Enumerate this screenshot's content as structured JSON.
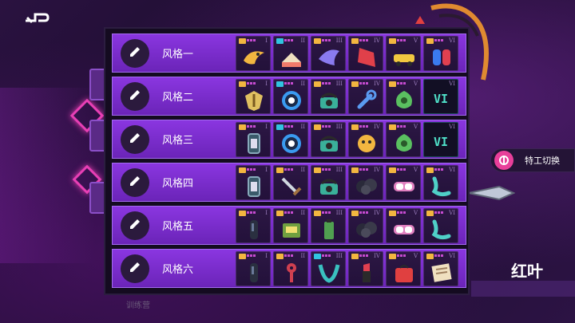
{
  "agent_switch": {
    "label": "特工切换"
  },
  "character": {
    "name": "红叶"
  },
  "bottom_hint": "训练营",
  "rows": [
    {
      "name": "风格一",
      "slots": [
        {
          "roman": "I",
          "tag": "yellow",
          "item": "golden-bird-icon",
          "color": "#f2b640"
        },
        {
          "roman": "II",
          "tag": "cyan",
          "item": "cake-icon",
          "color": "#f07a6a"
        },
        {
          "roman": "III",
          "tag": "yellow",
          "item": "blue-bird-icon",
          "color": "#8a7af0"
        },
        {
          "roman": "IV",
          "tag": "yellow",
          "item": "red-cape-icon",
          "color": "#e0404a"
        },
        {
          "roman": "V",
          "tag": "yellow",
          "item": "yellow-car-icon",
          "color": "#f2c840"
        },
        {
          "roman": "VI",
          "tag": "yellow",
          "item": "joycon-icon",
          "color": "#3a7af0"
        }
      ]
    },
    {
      "name": "风格二",
      "slots": [
        {
          "roman": "I",
          "tag": "yellow",
          "item": "crest-icon",
          "color": "#e0c060"
        },
        {
          "roman": "II",
          "tag": "cyan",
          "item": "target-disc-icon",
          "color": "#3a9af0"
        },
        {
          "roman": "III",
          "tag": "yellow",
          "item": "telephone-icon",
          "color": "#3ab09a"
        },
        {
          "roman": "IV",
          "tag": "yellow",
          "item": "wrench-icon",
          "color": "#5a9af0"
        },
        {
          "roman": "V",
          "tag": "yellow",
          "item": "green-leaf-icon",
          "color": "#5ac060"
        },
        {
          "roman": "VI",
          "tag": "dark",
          "item": "roman-six-label",
          "label": "VI"
        }
      ]
    },
    {
      "name": "风格三",
      "slots": [
        {
          "roman": "I",
          "tag": "yellow",
          "item": "canister-icon",
          "color": "#3a5a6a"
        },
        {
          "roman": "II",
          "tag": "cyan",
          "item": "target-disc-icon",
          "color": "#3a9af0"
        },
        {
          "roman": "III",
          "tag": "yellow",
          "item": "telephone-icon",
          "color": "#3ab09a"
        },
        {
          "roman": "IV",
          "tag": "yellow",
          "item": "pet-face-icon",
          "color": "#f2b640"
        },
        {
          "roman": "V",
          "tag": "yellow",
          "item": "green-leaf-icon",
          "color": "#5ac060"
        },
        {
          "roman": "VI",
          "tag": "dark",
          "item": "roman-six-label",
          "label": "VI"
        }
      ]
    },
    {
      "name": "风格四",
      "slots": [
        {
          "roman": "I",
          "tag": "yellow",
          "item": "canister-icon",
          "color": "#3a5a6a"
        },
        {
          "roman": "II",
          "tag": "yellow",
          "item": "sword-icon",
          "color": "#d0d8e0"
        },
        {
          "roman": "III",
          "tag": "yellow",
          "item": "telephone-icon",
          "color": "#3ab09a"
        },
        {
          "roman": "IV",
          "tag": "yellow",
          "item": "black-cloud-icon",
          "color": "#2a2a3a"
        },
        {
          "roman": "V",
          "tag": "yellow",
          "item": "goggles-icon",
          "color": "#e080c0"
        },
        {
          "roman": "VI",
          "tag": "yellow",
          "item": "cyan-worm-icon",
          "color": "#4fd0c8"
        }
      ]
    },
    {
      "name": "风格五",
      "slots": [
        {
          "roman": "I",
          "tag": "yellow",
          "item": "dark-vial-icon",
          "color": "#2a3040"
        },
        {
          "roman": "II",
          "tag": "yellow",
          "item": "green-machine-icon",
          "color": "#70a040"
        },
        {
          "roman": "III",
          "tag": "yellow",
          "item": "green-battery-icon",
          "color": "#50a050"
        },
        {
          "roman": "IV",
          "tag": "yellow",
          "item": "black-cloud-icon",
          "color": "#2a2a3a"
        },
        {
          "roman": "V",
          "tag": "yellow",
          "item": "goggles-icon",
          "color": "#e080c0"
        },
        {
          "roman": "VI",
          "tag": "yellow",
          "item": "cyan-worm-icon",
          "color": "#4fd0c8"
        }
      ]
    },
    {
      "name": "风格六",
      "slots": [
        {
          "roman": "I",
          "tag": "yellow",
          "item": "dark-vial-icon",
          "color": "#2a3040"
        },
        {
          "roman": "II",
          "tag": "yellow",
          "item": "red-key-icon",
          "color": "#d04050"
        },
        {
          "roman": "III",
          "tag": "cyan",
          "item": "teal-horns-icon",
          "color": "#3ac0c0"
        },
        {
          "roman": "IV",
          "tag": "yellow",
          "item": "lipstick-icon",
          "color": "#e04050"
        },
        {
          "roman": "V",
          "tag": "yellow",
          "item": "red-bag-icon",
          "color": "#e04040"
        },
        {
          "roman": "VI",
          "tag": "yellow",
          "item": "note-card-icon",
          "color": "#f0e0c0"
        }
      ]
    }
  ]
}
